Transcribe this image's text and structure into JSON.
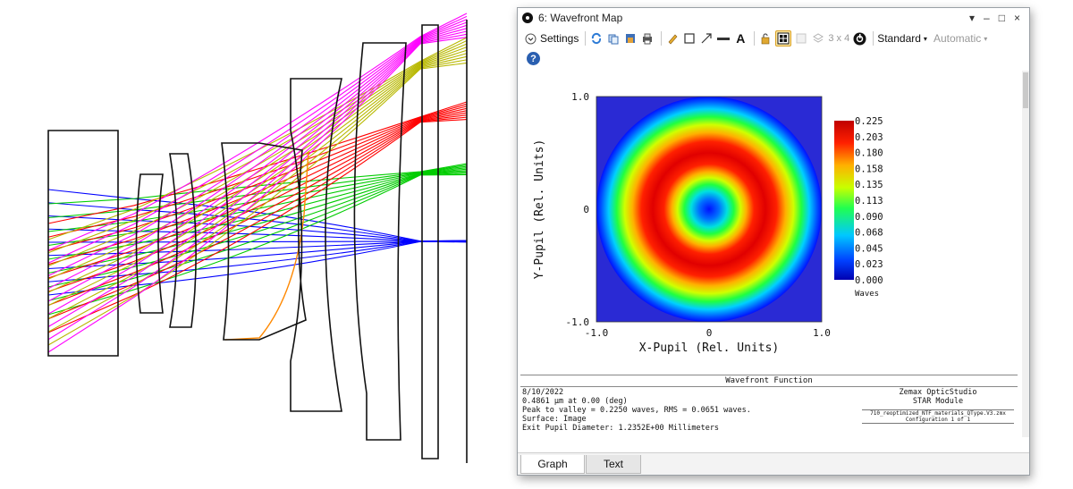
{
  "window": {
    "title": "6: Wavefront Map",
    "controls": [
      "▾",
      "–",
      "□",
      "×"
    ]
  },
  "toolbar": {
    "settings_label": "Settings",
    "grid_label": "3 x 4",
    "standard_label": "Standard",
    "automatic_label": "Automatic",
    "help_label": "?"
  },
  "plot": {
    "xlabel": "X-Pupil (Rel. Units)",
    "ylabel": "Y-Pupil (Rel. Units)",
    "xticks": [
      "-1.0",
      "0",
      "1.0"
    ],
    "yticks": [
      "1.0",
      "0",
      "-1.0"
    ],
    "colorbar_ticks": [
      "0.225",
      "0.203",
      "0.180",
      "0.158",
      "0.135",
      "0.113",
      "0.090",
      "0.068",
      "0.045",
      "0.023",
      "0.000"
    ],
    "colorbar_unit": "Waves"
  },
  "chart_data": {
    "type": "heatmap",
    "xlabel": "X-Pupil (Rel. Units)",
    "ylabel": "Y-Pupil (Rel. Units)",
    "xlim": [
      -1.0,
      1.0
    ],
    "ylim": [
      -1.0,
      1.0
    ],
    "colorbar_range": [
      0.0,
      0.225
    ],
    "colorbar_unit": "Waves",
    "radial_profile": {
      "r": [
        0.0,
        0.1,
        0.2,
        0.3,
        0.4,
        0.5,
        0.6,
        0.7,
        0.8,
        0.9,
        1.0
      ],
      "waves": [
        0.0,
        0.04,
        0.12,
        0.18,
        0.215,
        0.225,
        0.215,
        0.18,
        0.12,
        0.05,
        0.0
      ]
    }
  },
  "info": {
    "header": "Wavefront Function",
    "lines": [
      "8/10/2022",
      "0.4861 μm at 0.00 (deg)",
      "Peak to valley = 0.2250 waves, RMS = 0.0651 waves.",
      "Surface: Image",
      "Exit Pupil Diameter: 1.2352E+00 Millimeters"
    ],
    "right_lines": [
      "Zemax OpticStudio",
      "STAR Module"
    ],
    "right_small": [
      "710_reoptimized_NTF_materials_QType.V3.zmx",
      "Configuration 1 of 1"
    ]
  },
  "tabs": [
    "Graph",
    "Text"
  ],
  "colors": {
    "rays": [
      "#0000ff",
      "#00cc00",
      "#ff0000",
      "#b8b800",
      "#ff00ff",
      "#ff8800"
    ]
  }
}
